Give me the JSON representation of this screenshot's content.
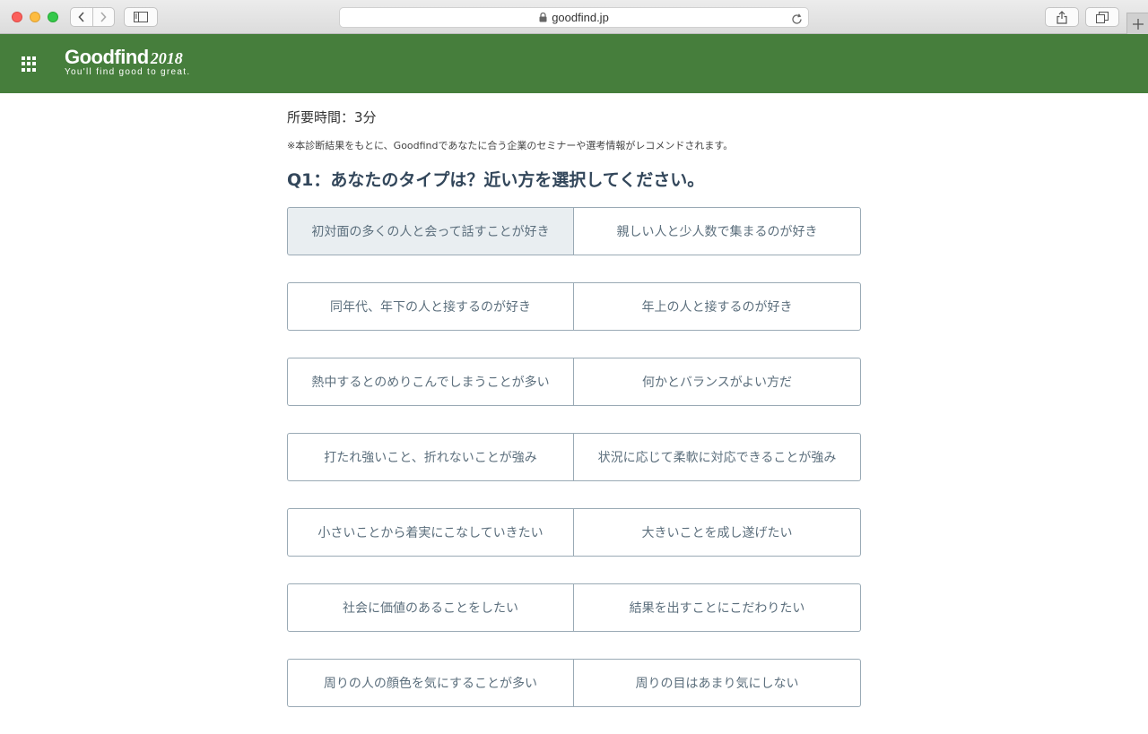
{
  "browser": {
    "url": "goodfind.jp"
  },
  "header": {
    "logo_name": "Goodfind",
    "logo_year": "2018",
    "tagline": "You'll find good to great."
  },
  "main": {
    "duration": "所要時間：3分",
    "note": "※本診断結果をもとに、Goodfindであなたに合う企業のセミナーや選考情報がレコメンドされます。",
    "question": "Q1：あなたのタイプは？近い方を選択してください。",
    "choices": [
      {
        "left": "初対面の多くの人と会って話すことが好き",
        "right": "親しい人と少人数で集まるのが好き",
        "selected": "left"
      },
      {
        "left": "同年代、年下の人と接するのが好き",
        "right": "年上の人と接するのが好き"
      },
      {
        "left": "熱中するとのめりこんでしまうことが多い",
        "right": "何かとバランスがよい方だ"
      },
      {
        "left": "打たれ強いこと、折れないことが強み",
        "right": "状況に応じて柔軟に対応できることが強み"
      },
      {
        "left": "小さいことから着実にこなしていきたい",
        "right": "大きいことを成し遂げたい"
      },
      {
        "left": "社会に価値のあることをしたい",
        "right": "結果を出すことにこだわりたい"
      },
      {
        "left": "周りの人の顔色を気にすることが多い",
        "right": "周りの目はあまり気にしない"
      }
    ]
  },
  "colors": {
    "header_bg": "#467e3c",
    "choice_border": "#9aaab5",
    "choice_text": "#5c6f7d",
    "selected_bg": "#e9eef1",
    "question_text": "#33475b"
  }
}
